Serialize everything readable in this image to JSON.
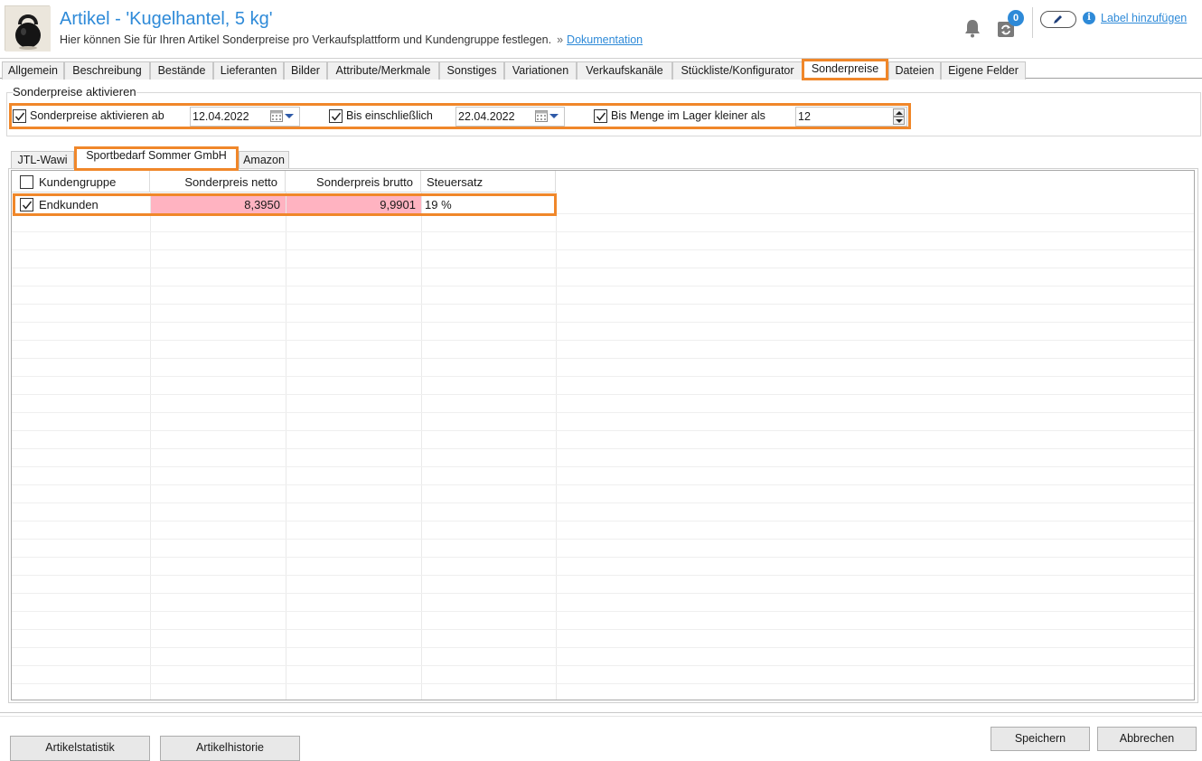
{
  "header": {
    "title": "Artikel - 'Kugelhantel, 5 kg'",
    "subtitle": "Hier können Sie für Ihren Artikel Sonderpreise pro Verkaufsplattform und Kundengruppe festlegen.",
    "separator": "»",
    "doc_link": "Dokumentation",
    "notification_count": "0",
    "label_link": "Label hinzufügen"
  },
  "tabs": [
    {
      "label": "Allgemein"
    },
    {
      "label": "Beschreibung"
    },
    {
      "label": "Bestände"
    },
    {
      "label": "Lieferanten"
    },
    {
      "label": "Bilder"
    },
    {
      "label": "Attribute/Merkmale"
    },
    {
      "label": "Sonstiges"
    },
    {
      "label": "Variationen"
    },
    {
      "label": "Verkaufskanäle"
    },
    {
      "label": "Stückliste/Konfigurator"
    },
    {
      "label": "Sonderpreise"
    },
    {
      "label": "Dateien"
    },
    {
      "label": "Eigene Felder"
    }
  ],
  "active_tab": "Sonderpreise",
  "activation": {
    "group_title": "Sonderpreise aktivieren",
    "from_label": "Sonderpreise aktivieren ab",
    "from_checked": true,
    "from_date": "12.04.2022",
    "until_label": "Bis einschließlich",
    "until_checked": true,
    "until_date": "22.04.2022",
    "stock_label": "Bis Menge im Lager kleiner als",
    "stock_checked": true,
    "stock_value": "12"
  },
  "platform_tabs": [
    {
      "label": "JTL-Wawi"
    },
    {
      "label": "Sportbedarf Sommer GmbH"
    },
    {
      "label": "Amazon"
    }
  ],
  "active_platform": "Sportbedarf Sommer GmbH",
  "grid": {
    "columns": [
      "Kundengruppe",
      "Sonderpreis netto",
      "Sonderpreis brutto",
      "Steuersatz"
    ],
    "rows": [
      {
        "checked": true,
        "group": "Endkunden",
        "netto": "8,3950",
        "brutto": "9,9901",
        "tax": "19 %"
      }
    ]
  },
  "footer": {
    "stats_button": "Artikelstatistik",
    "history_button": "Artikelhistorie",
    "save_button": "Speichern",
    "cancel_button": "Abbrechen"
  },
  "colors": {
    "accent": "#2e8ad8",
    "highlight": "#f0872a",
    "price_cell": "#ffb3c1"
  }
}
